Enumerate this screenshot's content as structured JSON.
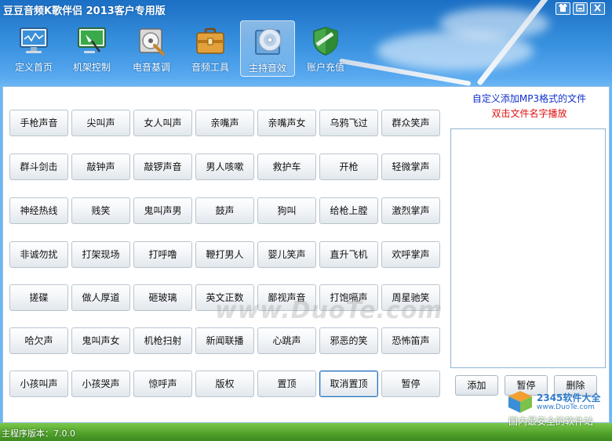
{
  "window": {
    "title": "豆豆音频K歌伴侣 2013客户专用版",
    "controls": [
      "shirt-icon",
      "minimize-icon",
      "close-icon"
    ]
  },
  "toolbar": {
    "items": [
      {
        "label": "定义首页",
        "icon": "monitor-icon"
      },
      {
        "label": "机架控制",
        "icon": "rack-control-icon"
      },
      {
        "label": "电音基调",
        "icon": "audio-tune-icon"
      },
      {
        "label": "音频工具",
        "icon": "toolbox-icon"
      },
      {
        "label": "主持音效",
        "icon": "disc-icon",
        "active": true
      },
      {
        "label": "账户充值",
        "icon": "shield-icon"
      }
    ]
  },
  "sound_buttons": [
    [
      "手枪声音",
      "尖叫声",
      "女人叫声",
      "亲嘴声",
      "亲嘴声女",
      "乌鸦飞过",
      "群众笑声"
    ],
    [
      "群斗剑击",
      "敲钟声",
      "敲锣声音",
      "男人咳嗽",
      "救护车",
      "开枪",
      "轻微掌声"
    ],
    [
      "神经热线",
      "贱笑",
      "鬼叫声男",
      "鼓声",
      "狗叫",
      "给枪上膛",
      "激烈掌声"
    ],
    [
      "非诚勿扰",
      "打架现场",
      "打呼噜",
      "鞭打男人",
      "婴儿笑声",
      "直升飞机",
      "欢呼掌声"
    ],
    [
      "搓碟",
      "做人厚道",
      "砸玻璃",
      "英文正数",
      "鄙视声音",
      "打饱嗝声",
      "周星驰笑"
    ],
    [
      "哈欠声",
      "鬼叫声女",
      "机枪扫射",
      "新闻联播",
      "心跳声",
      "邪恶的笑",
      "恐怖笛声"
    ],
    [
      "小孩叫声",
      "小孩哭声",
      "惊呼声",
      "版权",
      "置顶",
      "取消置顶",
      "暂停"
    ]
  ],
  "side": {
    "hint1": "自定义添加MP3格式的文件",
    "hint2": "双击文件名字播放",
    "add_label": "添加",
    "pause_label": "暂停",
    "delete_label": "删除"
  },
  "colors": {
    "hint1": "#1030c8",
    "hint2": "#e01010"
  },
  "watermark": "www.DuoTe.com",
  "status": {
    "version": "主程序版本：7.0.0"
  },
  "site_logo": {
    "name": "2345软件大全",
    "url": "www.DuoTe.com",
    "slogan": "国内最安全的软件站"
  }
}
